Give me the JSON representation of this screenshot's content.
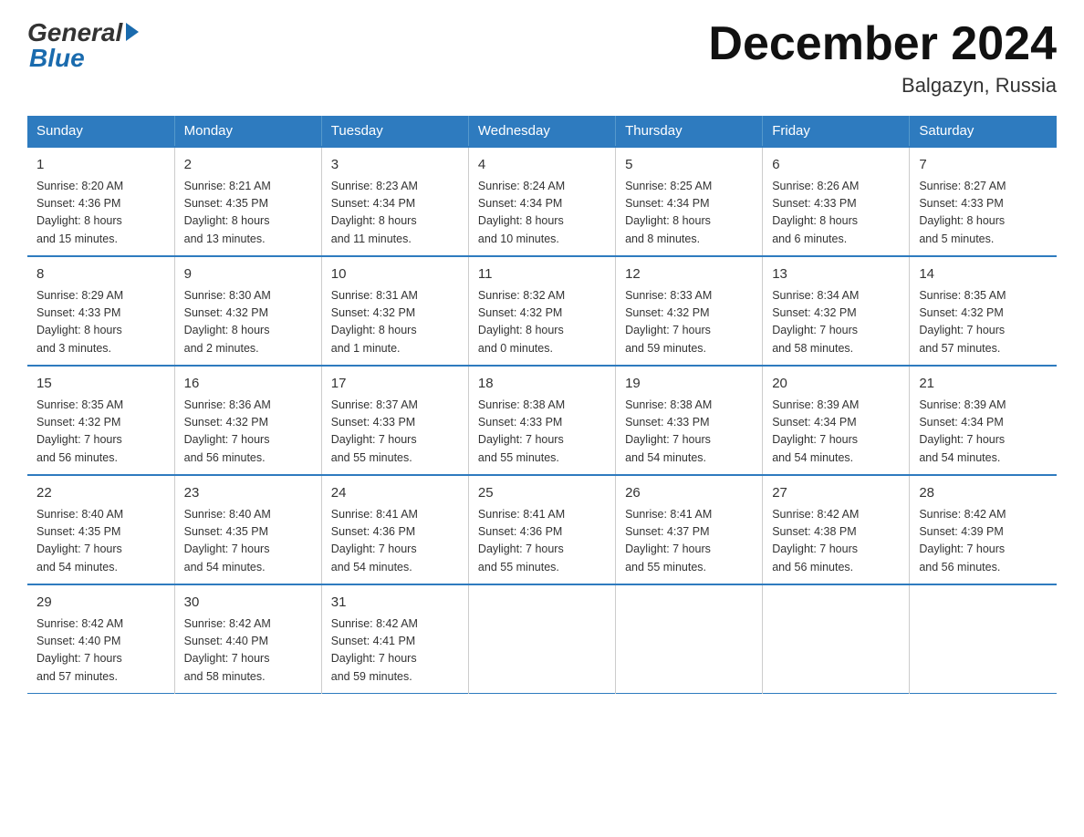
{
  "header": {
    "logo": {
      "general": "General",
      "blue": "Blue"
    },
    "title": "December 2024",
    "location": "Balgazyn, Russia"
  },
  "calendar": {
    "days_of_week": [
      "Sunday",
      "Monday",
      "Tuesday",
      "Wednesday",
      "Thursday",
      "Friday",
      "Saturday"
    ],
    "weeks": [
      [
        {
          "day": "1",
          "info": "Sunrise: 8:20 AM\nSunset: 4:36 PM\nDaylight: 8 hours\nand 15 minutes."
        },
        {
          "day": "2",
          "info": "Sunrise: 8:21 AM\nSunset: 4:35 PM\nDaylight: 8 hours\nand 13 minutes."
        },
        {
          "day": "3",
          "info": "Sunrise: 8:23 AM\nSunset: 4:34 PM\nDaylight: 8 hours\nand 11 minutes."
        },
        {
          "day": "4",
          "info": "Sunrise: 8:24 AM\nSunset: 4:34 PM\nDaylight: 8 hours\nand 10 minutes."
        },
        {
          "day": "5",
          "info": "Sunrise: 8:25 AM\nSunset: 4:34 PM\nDaylight: 8 hours\nand 8 minutes."
        },
        {
          "day": "6",
          "info": "Sunrise: 8:26 AM\nSunset: 4:33 PM\nDaylight: 8 hours\nand 6 minutes."
        },
        {
          "day": "7",
          "info": "Sunrise: 8:27 AM\nSunset: 4:33 PM\nDaylight: 8 hours\nand 5 minutes."
        }
      ],
      [
        {
          "day": "8",
          "info": "Sunrise: 8:29 AM\nSunset: 4:33 PM\nDaylight: 8 hours\nand 3 minutes."
        },
        {
          "day": "9",
          "info": "Sunrise: 8:30 AM\nSunset: 4:32 PM\nDaylight: 8 hours\nand 2 minutes."
        },
        {
          "day": "10",
          "info": "Sunrise: 8:31 AM\nSunset: 4:32 PM\nDaylight: 8 hours\nand 1 minute."
        },
        {
          "day": "11",
          "info": "Sunrise: 8:32 AM\nSunset: 4:32 PM\nDaylight: 8 hours\nand 0 minutes."
        },
        {
          "day": "12",
          "info": "Sunrise: 8:33 AM\nSunset: 4:32 PM\nDaylight: 7 hours\nand 59 minutes."
        },
        {
          "day": "13",
          "info": "Sunrise: 8:34 AM\nSunset: 4:32 PM\nDaylight: 7 hours\nand 58 minutes."
        },
        {
          "day": "14",
          "info": "Sunrise: 8:35 AM\nSunset: 4:32 PM\nDaylight: 7 hours\nand 57 minutes."
        }
      ],
      [
        {
          "day": "15",
          "info": "Sunrise: 8:35 AM\nSunset: 4:32 PM\nDaylight: 7 hours\nand 56 minutes."
        },
        {
          "day": "16",
          "info": "Sunrise: 8:36 AM\nSunset: 4:32 PM\nDaylight: 7 hours\nand 56 minutes."
        },
        {
          "day": "17",
          "info": "Sunrise: 8:37 AM\nSunset: 4:33 PM\nDaylight: 7 hours\nand 55 minutes."
        },
        {
          "day": "18",
          "info": "Sunrise: 8:38 AM\nSunset: 4:33 PM\nDaylight: 7 hours\nand 55 minutes."
        },
        {
          "day": "19",
          "info": "Sunrise: 8:38 AM\nSunset: 4:33 PM\nDaylight: 7 hours\nand 54 minutes."
        },
        {
          "day": "20",
          "info": "Sunrise: 8:39 AM\nSunset: 4:34 PM\nDaylight: 7 hours\nand 54 minutes."
        },
        {
          "day": "21",
          "info": "Sunrise: 8:39 AM\nSunset: 4:34 PM\nDaylight: 7 hours\nand 54 minutes."
        }
      ],
      [
        {
          "day": "22",
          "info": "Sunrise: 8:40 AM\nSunset: 4:35 PM\nDaylight: 7 hours\nand 54 minutes."
        },
        {
          "day": "23",
          "info": "Sunrise: 8:40 AM\nSunset: 4:35 PM\nDaylight: 7 hours\nand 54 minutes."
        },
        {
          "day": "24",
          "info": "Sunrise: 8:41 AM\nSunset: 4:36 PM\nDaylight: 7 hours\nand 54 minutes."
        },
        {
          "day": "25",
          "info": "Sunrise: 8:41 AM\nSunset: 4:36 PM\nDaylight: 7 hours\nand 55 minutes."
        },
        {
          "day": "26",
          "info": "Sunrise: 8:41 AM\nSunset: 4:37 PM\nDaylight: 7 hours\nand 55 minutes."
        },
        {
          "day": "27",
          "info": "Sunrise: 8:42 AM\nSunset: 4:38 PM\nDaylight: 7 hours\nand 56 minutes."
        },
        {
          "day": "28",
          "info": "Sunrise: 8:42 AM\nSunset: 4:39 PM\nDaylight: 7 hours\nand 56 minutes."
        }
      ],
      [
        {
          "day": "29",
          "info": "Sunrise: 8:42 AM\nSunset: 4:40 PM\nDaylight: 7 hours\nand 57 minutes."
        },
        {
          "day": "30",
          "info": "Sunrise: 8:42 AM\nSunset: 4:40 PM\nDaylight: 7 hours\nand 58 minutes."
        },
        {
          "day": "31",
          "info": "Sunrise: 8:42 AM\nSunset: 4:41 PM\nDaylight: 7 hours\nand 59 minutes."
        },
        {
          "day": "",
          "info": ""
        },
        {
          "day": "",
          "info": ""
        },
        {
          "day": "",
          "info": ""
        },
        {
          "day": "",
          "info": ""
        }
      ]
    ]
  }
}
